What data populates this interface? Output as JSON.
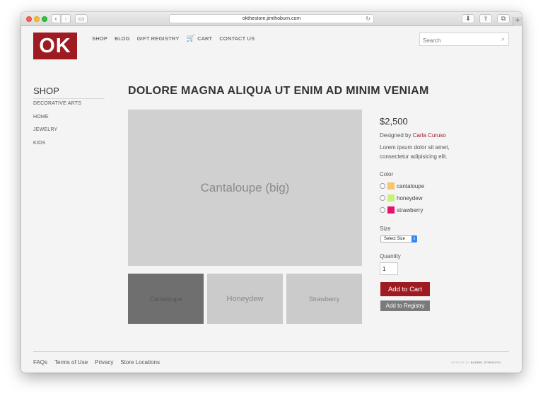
{
  "browser": {
    "url": "okthestore.jimthoburn.com",
    "back_icon": "‹",
    "forward_icon": "›",
    "sidebar_icon": "▭",
    "reload_icon": "↻",
    "download_icon": "⬇",
    "share_icon": "⇪",
    "tabs_icon": "⧉",
    "new_tab_icon": "+"
  },
  "header": {
    "logo": "OK",
    "nav": [
      "SHOP",
      "BLOG",
      "GIFT REGISTRY",
      "CART",
      "CONTACT US"
    ],
    "cart_icon": "🛒",
    "search_placeholder": "Search",
    "search_icon": "⌕"
  },
  "sidebar": {
    "title": "SHOP",
    "items": [
      "DECORATIVE ARTS",
      "HOME",
      "JEWELRY",
      "KIDS"
    ]
  },
  "product": {
    "title": "DOLORE MAGNA ALIQUA UT ENIM AD MINIM VENIAM",
    "main_image_label": "Cantaloupe (big)",
    "thumbnails": [
      "Cantaloupe",
      "Honeydew",
      "Strawberry"
    ],
    "price": "$2,500",
    "designed_by_prefix": "Designed by ",
    "designer": "Carla Curuso",
    "description": "Lorem ipsum dolor sit amet, consectetur adipisicing elit.",
    "color_label": "Color",
    "colors": [
      {
        "label": "cantaloupe",
        "hex": "#f7c56e"
      },
      {
        "label": "honeydew",
        "hex": "#c7f278"
      },
      {
        "label": "strawberry",
        "hex": "#e8126e"
      }
    ],
    "size_label": "Size",
    "size_selected": "Select Size",
    "quantity_label": "Quantity",
    "quantity_value": "1",
    "add_to_cart": "Add to Cart",
    "add_to_registry": "Add to Registry"
  },
  "footer": {
    "links": [
      "FAQs",
      "Terms of Use",
      "Privacy",
      "Store Locations"
    ],
    "credit_prefix": "WEBSITE BY ",
    "credit_name": "BARREL STRENGTH"
  },
  "colors": {
    "brand": "#9e1b22",
    "registry_button": "#7a7a7a"
  }
}
